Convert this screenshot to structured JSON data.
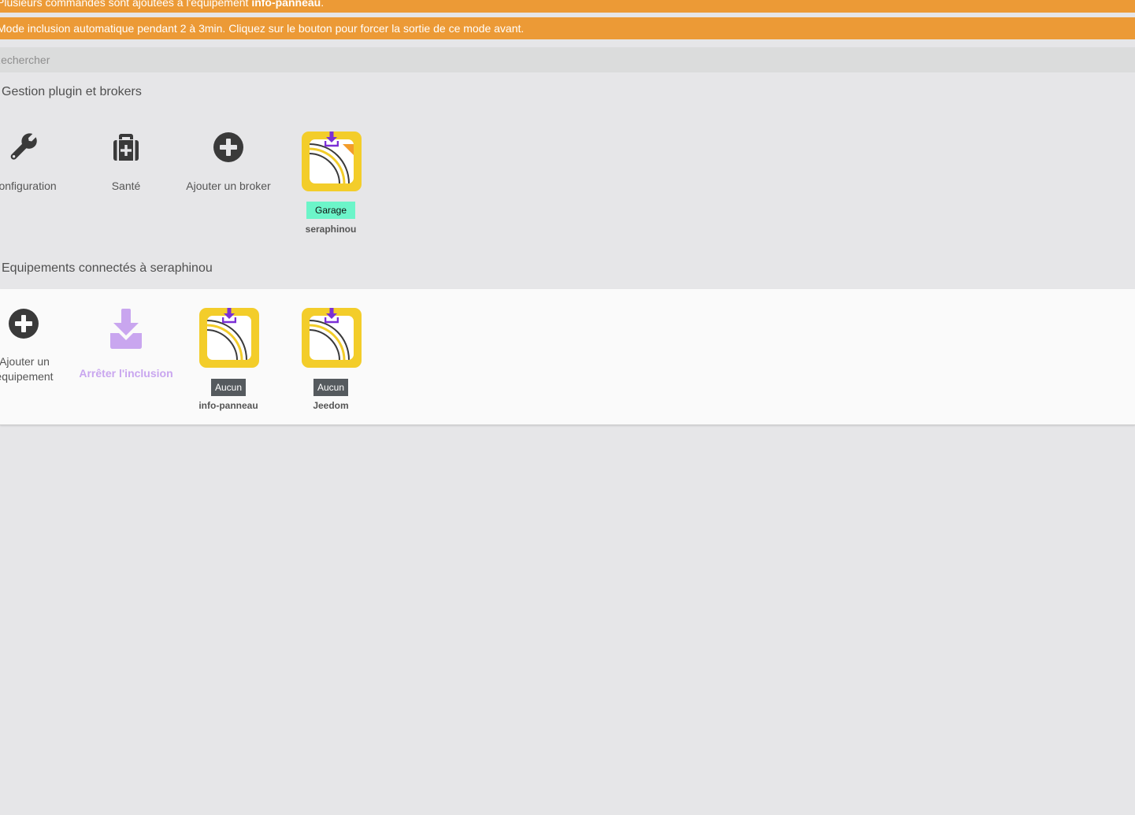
{
  "alerts": {
    "commands": {
      "prefix": "Plusieurs commandes sont ajoutées à l'équipement ",
      "strong": "info-panneau",
      "suffix": "."
    },
    "inclusion": "Mode inclusion automatique pendant 2 à 3min. Cliquez sur le bouton pour forcer la sortie de ce mode avant."
  },
  "search": {
    "placeholder": "Rechercher"
  },
  "sections": {
    "plugin": {
      "title": "Gestion plugin et brokers",
      "tiles": {
        "configuration": "Configuration",
        "health": "Santé",
        "add_broker": "Ajouter un broker"
      },
      "broker": {
        "badge": "Garage",
        "name": "seraphinou"
      }
    },
    "equipments": {
      "title": "Equipements connectés à seraphinou",
      "add_equipment_line1": "Ajouter un",
      "add_equipment_line2": "équipement",
      "stop_inclusion": "Arrêter l'inclusion",
      "items": [
        {
          "badge": "Aucun",
          "name": "info-panneau"
        },
        {
          "badge": "Aucun",
          "name": "Jeedom"
        }
      ]
    }
  },
  "colors": {
    "alert": "#ec9a36",
    "inclusion_purple": "#c9a6ef",
    "plugin_yellow": "#f3cd2a",
    "badge_green": "#6cf5c9",
    "badge_dark": "#555a5e",
    "icon_dark": "#3a3a3a"
  },
  "icons": {
    "configuration": "wrench-icon",
    "health": "medkit-icon",
    "add": "plus-circle-icon",
    "stop_inclusion": "download-icon",
    "plugin": "mqtt-plugin-icon"
  }
}
